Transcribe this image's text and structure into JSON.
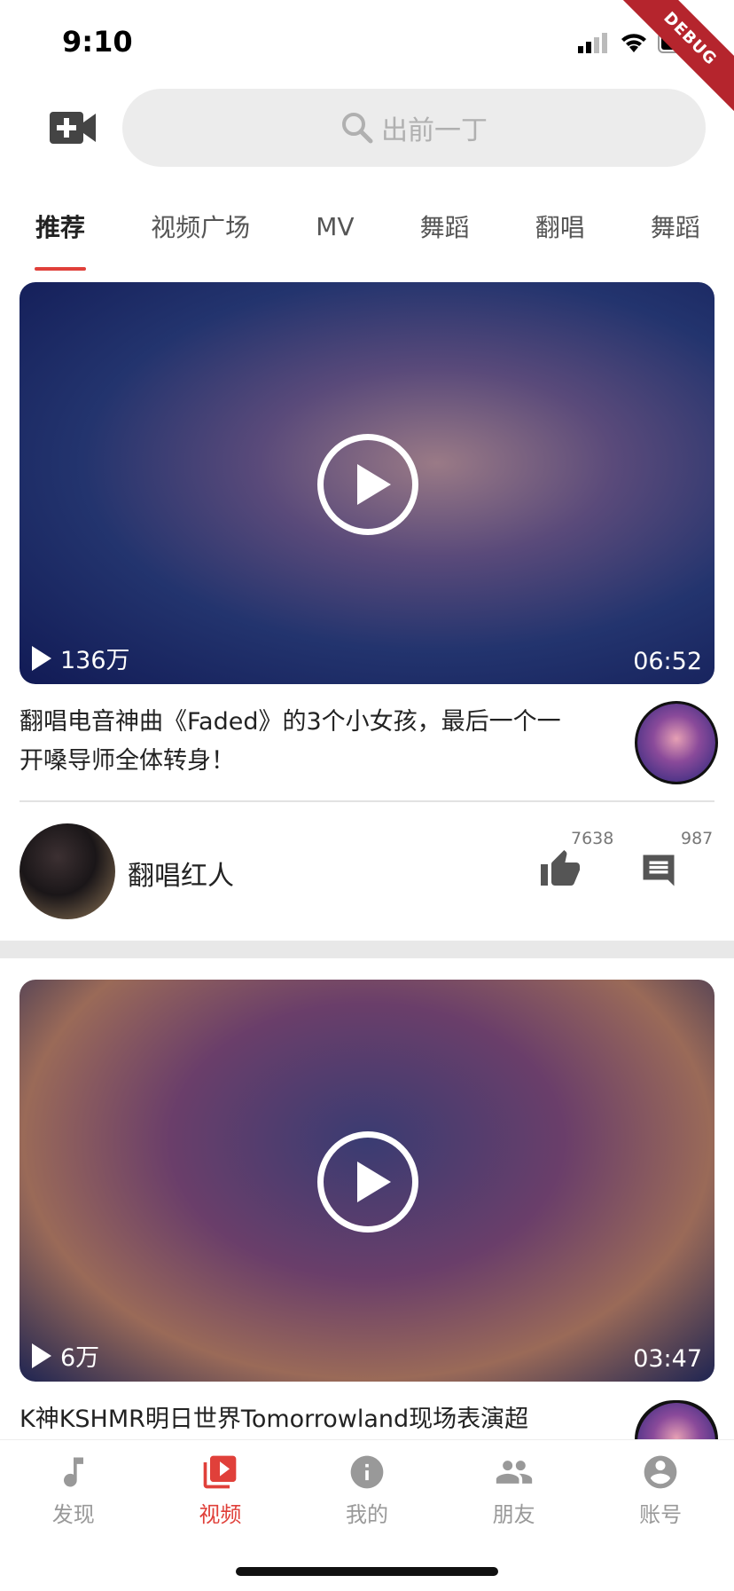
{
  "status_bar": {
    "time": "9:10",
    "debug_label": "DEBUG"
  },
  "header": {
    "search_placeholder": "出前一丁"
  },
  "tabs": [
    {
      "label": "推荐",
      "active": true
    },
    {
      "label": "视频广场"
    },
    {
      "label": "MV"
    },
    {
      "label": "舞蹈"
    },
    {
      "label": "翻唱"
    },
    {
      "label": "舞蹈"
    }
  ],
  "videos": [
    {
      "views": "136万",
      "duration": "06:52",
      "title": "翻唱电音神曲《Faded》的3个小女孩，最后一个一开嗓导师全体转身！",
      "author": "翻唱红人",
      "likes": "7638",
      "comments": "987"
    },
    {
      "views": "6万",
      "duration": "03:47",
      "title": "K神KSHMR明日世界Tomorrowland现场表演超"
    }
  ],
  "bottom_nav": [
    {
      "label": "发现",
      "icon": "music-note-icon"
    },
    {
      "label": "视频",
      "icon": "video-library-icon",
      "active": true
    },
    {
      "label": "我的",
      "icon": "info-icon"
    },
    {
      "label": "朋友",
      "icon": "people-icon"
    },
    {
      "label": "账号",
      "icon": "account-circle-icon"
    }
  ],
  "colors": {
    "accent": "#e0403a",
    "search_bg": "#ececec",
    "inactive": "#999999"
  }
}
